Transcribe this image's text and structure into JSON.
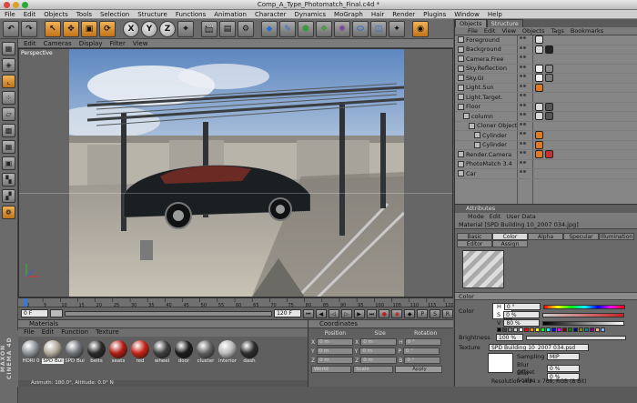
{
  "window": {
    "title": "Comp_A_Type_Photomatch_Final.c4d *"
  },
  "menubar": [
    "File",
    "Edit",
    "Objects",
    "Tools",
    "Selection",
    "Structure",
    "Functions",
    "Animation",
    "Character",
    "Dynamics",
    "MoGraph",
    "Hair",
    "Render",
    "Plugins",
    "Window",
    "Help"
  ],
  "toolbar": {
    "x_label": "X",
    "y_label": "Y",
    "z_label": "Z"
  },
  "viewport": {
    "menu": [
      "Edit",
      "Cameras",
      "Display",
      "Filter",
      "View"
    ],
    "label": "Perspective",
    "axes": {
      "x": "x",
      "y": "y",
      "z": "z"
    }
  },
  "transport": {
    "start_frame": "0 F",
    "end_frame": "120 F",
    "frame_field": "0 F"
  },
  "timeline_ticks": [
    "0",
    "5",
    "10",
    "15",
    "20",
    "25",
    "30",
    "35",
    "40",
    "45",
    "50",
    "55",
    "60",
    "65",
    "70",
    "75",
    "80",
    "85",
    "90",
    "95",
    "100",
    "105",
    "110",
    "115",
    "120"
  ],
  "materials": {
    "title": "Materials",
    "menu": [
      "File",
      "Edit",
      "Function",
      "Texture"
    ],
    "items": [
      {
        "label": "HDRI 0",
        "color": "#8d9296"
      },
      {
        "label": "SPD Bui",
        "color": "#b0a89a"
      },
      {
        "label": "SPD Bui",
        "color": "#6d7176"
      },
      {
        "label": "belts",
        "color": "#2a2a2a"
      },
      {
        "label": "seats",
        "color": "#b01d14"
      },
      {
        "label": "red",
        "color": "#c42318"
      },
      {
        "label": "wheel",
        "color": "#3e3e3e"
      },
      {
        "label": "door",
        "color": "#1c1c1c"
      },
      {
        "label": "cluster",
        "color": "#606060"
      },
      {
        "label": "interior",
        "color": "#b9b9b9"
      },
      {
        "label": "dash",
        "color": "#2d2d2d"
      }
    ]
  },
  "coordinates": {
    "title": "Coordinates",
    "col_headers": [
      "Position",
      "Size",
      "Rotation"
    ],
    "rows": [
      {
        "axis": "X",
        "pos": "0 m",
        "size_axis": "X",
        "size": "0 m",
        "rot_axis": "H",
        "rot": "0 °"
      },
      {
        "axis": "Y",
        "pos": "0 m",
        "size_axis": "Y",
        "size": "0 m",
        "rot_axis": "P",
        "rot": "0 °"
      },
      {
        "axis": "Z",
        "pos": "0 m",
        "size_axis": "Z",
        "size": "0 m",
        "rot_axis": "B",
        "rot": "0 °"
      }
    ],
    "mode": "World",
    "scale_mode": "Scale",
    "apply_label": "Apply"
  },
  "status": {
    "text": "Azimuth: 180.0°, Altitude: 0.0°  N"
  },
  "brand": "MAXON CINEMA 4D",
  "objects_panel": {
    "tabs": [
      "Objects",
      "Structure"
    ],
    "menu": [
      "File",
      "Edit",
      "View",
      "Objects",
      "Tags",
      "Bookmarks"
    ],
    "items": [
      {
        "name": "Foreground",
        "indent": 0,
        "tags": [
          "#e0e0e0"
        ]
      },
      {
        "name": "Background",
        "indent": 0,
        "tags": [
          "#d8d8d8",
          "#222"
        ]
      },
      {
        "name": "Camera.Free",
        "indent": 0,
        "tags": []
      },
      {
        "name": "Sky.Reflection",
        "indent": 0,
        "tags": [
          "#f0f0f0",
          "#8a8a8a"
        ]
      },
      {
        "name": "Sky.GI",
        "indent": 0,
        "tags": [
          "#f0f0f0",
          "#7a7a7a"
        ]
      },
      {
        "name": "Light.Sun",
        "indent": 0,
        "tags": [
          "#e07a22"
        ]
      },
      {
        "name": "Light.Target.",
        "indent": 0,
        "tags": []
      },
      {
        "name": "Floor",
        "indent": 0,
        "tags": [
          "#d9d9d9",
          "#555"
        ]
      },
      {
        "name": "column",
        "indent": 1,
        "tags": [
          "#d9d9d9",
          "#555"
        ]
      },
      {
        "name": "Cloner Object",
        "indent": 2,
        "tags": []
      },
      {
        "name": "Cylinder",
        "indent": 3,
        "tags": [
          "#e07a22"
        ]
      },
      {
        "name": "Cylinder",
        "indent": 3,
        "tags": [
          "#e07a22"
        ]
      },
      {
        "name": "Render.Camera",
        "indent": 0,
        "tags": [
          "#e07a22",
          "#c83030"
        ]
      },
      {
        "name": "PhotoMatch 3.4",
        "indent": 0,
        "tags": []
      },
      {
        "name": "Car",
        "indent": 0,
        "tags": []
      }
    ]
  },
  "attributes": {
    "header": "Attributes",
    "menu": [
      "Mode",
      "Edit",
      "User Data"
    ],
    "title": "Material [SPD Building 10_2007 034.jpg]",
    "tabs": [
      "Basic",
      "Color",
      "Alpha",
      "Specular",
      "Illumination",
      "Editor",
      "Assign"
    ],
    "active_tab": "Color",
    "section": "Color",
    "color_label": "Color",
    "h_label": "H",
    "h_value": "0 °",
    "s_label": "S",
    "s_value": "0 %",
    "v_label": "V",
    "v_value": "80 %",
    "brightness_label": "Brightness",
    "brightness_value": "100 %",
    "texture_label": "Texture",
    "texture_value": "SPD Building 10_2007 034.psd",
    "sampling_label": "Sampling",
    "sampling_value": "MIP",
    "blur_offset_label": "Blur Offset",
    "blur_offset_value": "0 %",
    "blur_scale_label": "Blur Scale",
    "blur_scale_value": "0 %",
    "resolution": "Resolution 1024 x 768, RGB (8 Bit)"
  }
}
